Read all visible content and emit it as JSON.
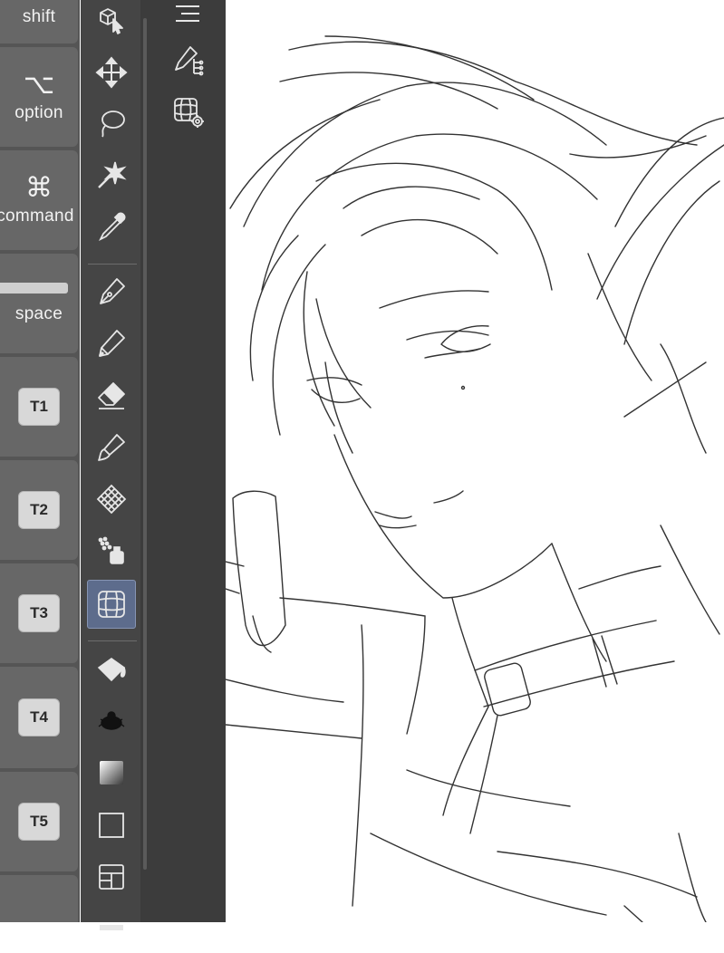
{
  "modifier_keys": [
    {
      "id": "shift",
      "glyph": "",
      "label": "shift"
    },
    {
      "id": "option",
      "glyph": "⌥",
      "label": "option"
    },
    {
      "id": "command",
      "glyph": "⌘",
      "label": "command"
    },
    {
      "id": "space",
      "glyph": "",
      "label": "space"
    },
    {
      "id": "t1",
      "chip": "T1"
    },
    {
      "id": "t2",
      "chip": "T2"
    },
    {
      "id": "t3",
      "chip": "T3"
    },
    {
      "id": "t4",
      "chip": "T4"
    },
    {
      "id": "t5",
      "chip": "T5"
    }
  ],
  "tools": [
    {
      "id": "object-select",
      "icon": "cube-cursor-icon"
    },
    {
      "id": "move",
      "icon": "move-arrows-icon"
    },
    {
      "id": "lasso",
      "icon": "lasso-icon"
    },
    {
      "id": "auto-select",
      "icon": "magic-wand-icon"
    },
    {
      "id": "eyedropper",
      "icon": "eyedropper-icon"
    },
    {
      "id": "pen",
      "icon": "pen-nib-icon"
    },
    {
      "id": "pencil",
      "icon": "pencil-icon"
    },
    {
      "id": "eraser",
      "icon": "eraser-icon"
    },
    {
      "id": "brush",
      "icon": "brush-icon"
    },
    {
      "id": "decoration",
      "icon": "pattern-icon"
    },
    {
      "id": "airbrush",
      "icon": "airbrush-icon"
    },
    {
      "id": "perspective-ruler",
      "icon": "grid-ruler-icon",
      "selected": true
    },
    {
      "id": "fill",
      "icon": "paint-bucket-icon"
    },
    {
      "id": "blend",
      "icon": "blend-blob-icon"
    },
    {
      "id": "gradient",
      "icon": "gradient-icon"
    },
    {
      "id": "figure",
      "icon": "rectangle-icon"
    },
    {
      "id": "frame-border",
      "icon": "frame-layout-icon"
    }
  ],
  "subtools": [
    {
      "id": "layer-list",
      "icon": "layer-list-icon"
    },
    {
      "id": "ruler-pen",
      "icon": "ruler-pen-icon"
    },
    {
      "id": "grid-settings",
      "icon": "grid-settings-icon"
    }
  ],
  "colors": {
    "key_panel": "#555555",
    "key_button": "#676767",
    "tool_panel": "#454545",
    "subtool_panel": "#3c3c3c",
    "selected_tool": "#5d6c8c",
    "canvas": "#ffffff"
  }
}
